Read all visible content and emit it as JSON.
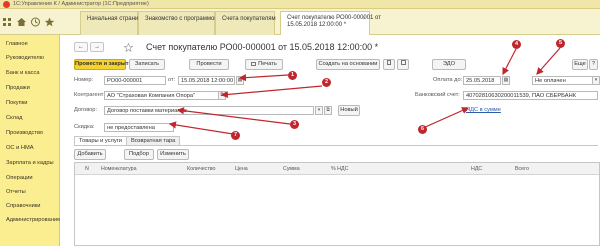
{
  "window": {
    "title": "1С:Управление К / Администратор (1С:Предприятие)"
  },
  "tabs": [
    {
      "label": "Начальная страница"
    },
    {
      "label": "Знакомство с программой"
    },
    {
      "label": "Счета покупателям"
    },
    {
      "label": "Счет покупателю РО00-000001 от",
      "label2": "15.05.2018 12:00:00 *",
      "close": "×"
    }
  ],
  "sidebar": {
    "items": [
      {
        "label": "Главное"
      },
      {
        "label": "Руководителю"
      },
      {
        "label": "Банк и касса"
      },
      {
        "label": "Продажи"
      },
      {
        "label": "Покупки"
      },
      {
        "label": "Склад"
      },
      {
        "label": "Производство"
      },
      {
        "label": "ОС и НМА"
      },
      {
        "label": "Зарплата и кадры"
      },
      {
        "label": "Операции"
      },
      {
        "label": "Отчеты"
      },
      {
        "label": "Справочники"
      },
      {
        "label": "Администрирование"
      }
    ]
  },
  "doc": {
    "back": "←",
    "forward": "→",
    "title": "Счет покупателю РО00-000001 от 15.05.2018 12:00:00 *",
    "toolbar": {
      "post_close": "Провести и закрыть",
      "save": "Записать",
      "post": "Провести",
      "print": "Печать",
      "create_based": "Создать на основании",
      "edo": "ЭДО",
      "more": "Еще",
      "help": "?"
    },
    "fields": {
      "number_label": "Номер:",
      "number_value": "РО00-000001",
      "date_label": "от:",
      "date_value": "15.05.2018 12:00:00",
      "pay_until_label": "Оплата до:",
      "pay_until_value": "25.05.2018",
      "status_value": "Не оплачен",
      "counterparty_label": "Контрагент:",
      "counterparty_value": "АО \"Страховая Компания Опора\"",
      "bank_label": "Банковский счет:",
      "bank_value": "40702810630200011539, ПАО СБЕРБАНК",
      "contract_label": "Договор:",
      "contract_value": "Договор поставки материалов",
      "new_button": "Новый",
      "discount_label": "Скидка:",
      "discount_value": "не предоставлена",
      "vat_link": "НДС в сумме"
    },
    "subtabs": [
      {
        "label": "Товары и услуги"
      },
      {
        "label": "Возвратная тара"
      }
    ],
    "table_toolbar": {
      "add": "Добавить",
      "select": "Подбор",
      "change": "Изменить"
    },
    "table_headers": [
      "N",
      "Номенклатура",
      "Количество",
      "Цена",
      "Сумма",
      "% НДС",
      "НДС",
      "Всего"
    ],
    "markers": [
      "1",
      "2",
      "3",
      "4",
      "5",
      "6",
      "7"
    ]
  },
  "colors": {
    "accent": "#f6d22f",
    "sidebar": "#fbee91",
    "marker": "#c0262e",
    "link": "#2c5ba8"
  }
}
